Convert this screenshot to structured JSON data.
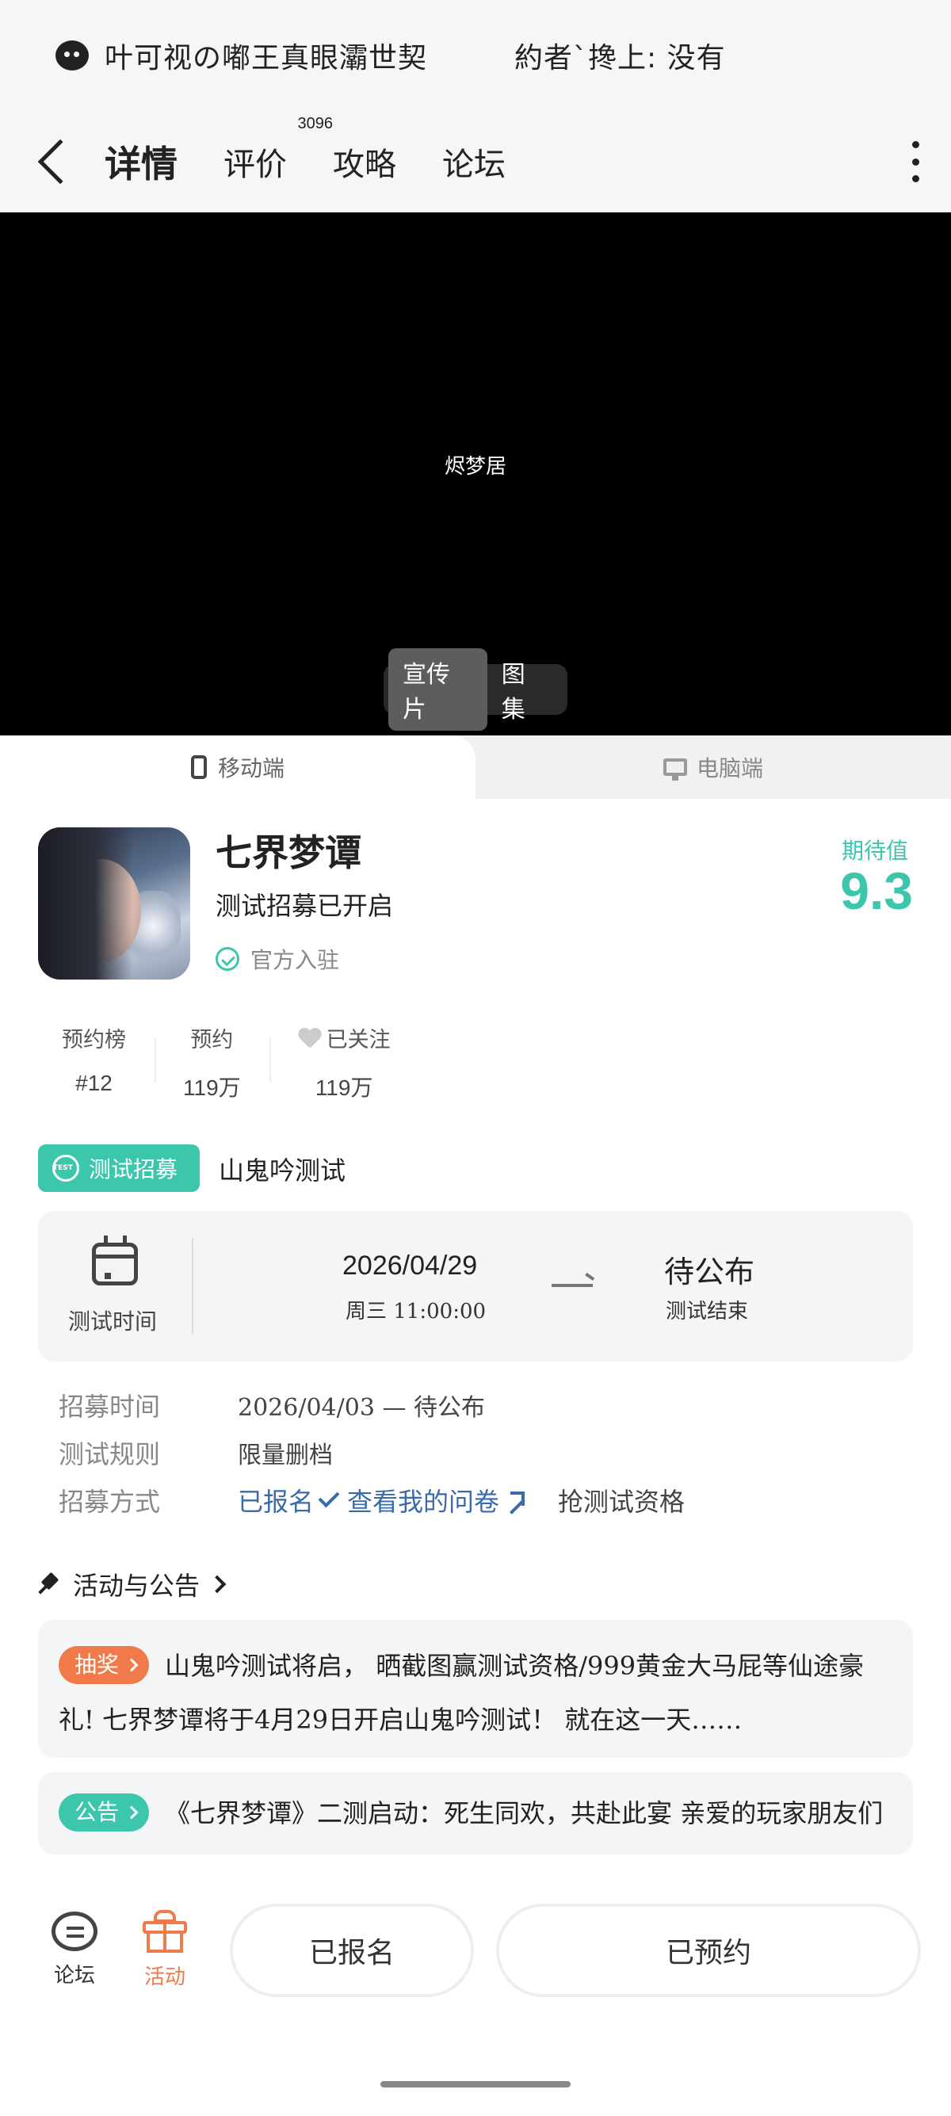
{
  "notification": {
    "text_left": "叶可视の嘟王真眼灞世契",
    "text_right": "約者`搀上: 没有"
  },
  "nav": {
    "tabs": [
      {
        "label": "详情"
      },
      {
        "label": "评价",
        "badge": "3096"
      },
      {
        "label": "攻略"
      },
      {
        "label": "论坛"
      }
    ]
  },
  "video": {
    "center_text": "烬梦居",
    "switch": [
      "宣传片",
      "图集"
    ]
  },
  "platforms": {
    "mobile": "移动端",
    "pc": "电脑端"
  },
  "game": {
    "title": "七界梦谭",
    "subtitle": "测试招募已开启",
    "official": "官方入驻",
    "expect_label": "期待值",
    "expect_value": "9.3"
  },
  "stats": [
    {
      "label": "预约榜",
      "value": "#12"
    },
    {
      "label": "预约",
      "value": "119万"
    },
    {
      "label": "已关注",
      "value": "119万"
    }
  ],
  "recruit": {
    "badge": "测试招募",
    "name": "山鬼吟测试",
    "time_label": "测试时间",
    "start_date": "2026/04/29",
    "start_weekday_time": "周三   11:00:00",
    "end_value": "待公布",
    "end_label": "测试结束",
    "rows": [
      {
        "key": "招募时间",
        "value": "2026/04/03 — 待公布"
      },
      {
        "key": "测试规则",
        "value": "限量删档"
      }
    ],
    "method_key": "招募方式",
    "method_signed": "已报名",
    "method_survey": "查看我的问卷",
    "method_grab": "抢测试资格"
  },
  "activities": {
    "title": "活动与公告",
    "items": [
      {
        "tag": "抽奖",
        "text": "山鬼吟测试将启， 晒截图赢测试资格/999黄金大马屁等仙途豪礼! 七界梦谭将于4月29日开启山鬼吟测试！ 就在这一天……"
      },
      {
        "tag": "公告",
        "text": "《七界梦谭》二测启动：死生同欢，共赴此宴 亲爱的玩家朋友们"
      }
    ]
  },
  "bottom": {
    "forum": "论坛",
    "activity": "活动",
    "btn_signed": "已报名",
    "btn_reserved": "已预约"
  },
  "colors": {
    "accent": "#3cc7ad",
    "orange": "#f07a4a",
    "link": "#3a6ba8"
  }
}
